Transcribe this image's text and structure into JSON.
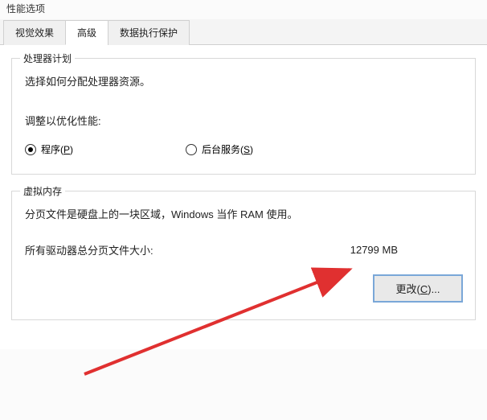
{
  "window": {
    "title_partial": "性能选项"
  },
  "tabs": {
    "visual": "视觉效果",
    "advanced": "高级",
    "dep": "数据执行保护"
  },
  "processor": {
    "title": "处理器计划",
    "desc": "选择如何分配处理器资源。",
    "adjust_label": "调整以优化性能:",
    "programs_prefix": "程序(",
    "programs_key": "P",
    "programs_suffix": ")",
    "bg_prefix": "后台服务(",
    "bg_key": "S",
    "bg_suffix": ")"
  },
  "vm": {
    "title": "虚拟内存",
    "desc": "分页文件是硬盘上的一块区域，Windows 当作 RAM 使用。",
    "total_label": "所有驱动器总分页文件大小:",
    "total_value": "12799 MB",
    "change_prefix": "更改(",
    "change_key": "C",
    "change_suffix": ")..."
  }
}
